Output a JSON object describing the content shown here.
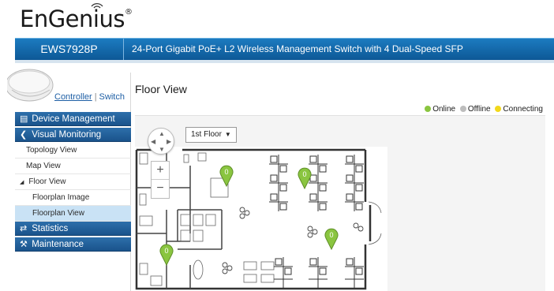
{
  "brand": {
    "name": "EnGenius",
    "trademark": "®"
  },
  "header": {
    "model": "EWS7928P",
    "description": "24-Port Gigabit PoE+ L2 Wireless Management Switch with 4 Dual-Speed SFP"
  },
  "mode": {
    "controller": "Controller",
    "separator": "|",
    "switch": "Switch"
  },
  "sidebar": {
    "sections": [
      {
        "label": "Device Management",
        "icon": "device-management-icon"
      },
      {
        "label": "Visual Monitoring",
        "icon": "share-icon",
        "items": [
          {
            "label": "Topology View"
          },
          {
            "label": "Map View"
          },
          {
            "label": "Floor View",
            "expanded": true,
            "children": [
              {
                "label": "Floorplan Image"
              },
              {
                "label": "Floorplan View",
                "selected": true
              }
            ]
          }
        ]
      },
      {
        "label": "Statistics",
        "icon": "statistics-icon"
      },
      {
        "label": "Maintenance",
        "icon": "wrench-icon"
      }
    ]
  },
  "main": {
    "title": "Floor View",
    "legend": [
      {
        "label": "Online",
        "color": "#8ac540"
      },
      {
        "label": "Offline",
        "color": "#bdbdbd"
      },
      {
        "label": "Connecting",
        "color": "#f2d81b"
      }
    ],
    "floor_selector": {
      "value": "1st Floor"
    },
    "zoom": {
      "in": "+",
      "out": "−"
    },
    "markers": [
      {
        "label": "0",
        "status": "online"
      },
      {
        "label": "0",
        "status": "online"
      },
      {
        "label": "0",
        "status": "online"
      },
      {
        "label": "0",
        "status": "online"
      }
    ]
  },
  "colors": {
    "header_blue": "#0d5896",
    "nav_blue": "#1a538b",
    "selected_bg": "#c9e2f5",
    "marker_green": "#8ac540"
  }
}
